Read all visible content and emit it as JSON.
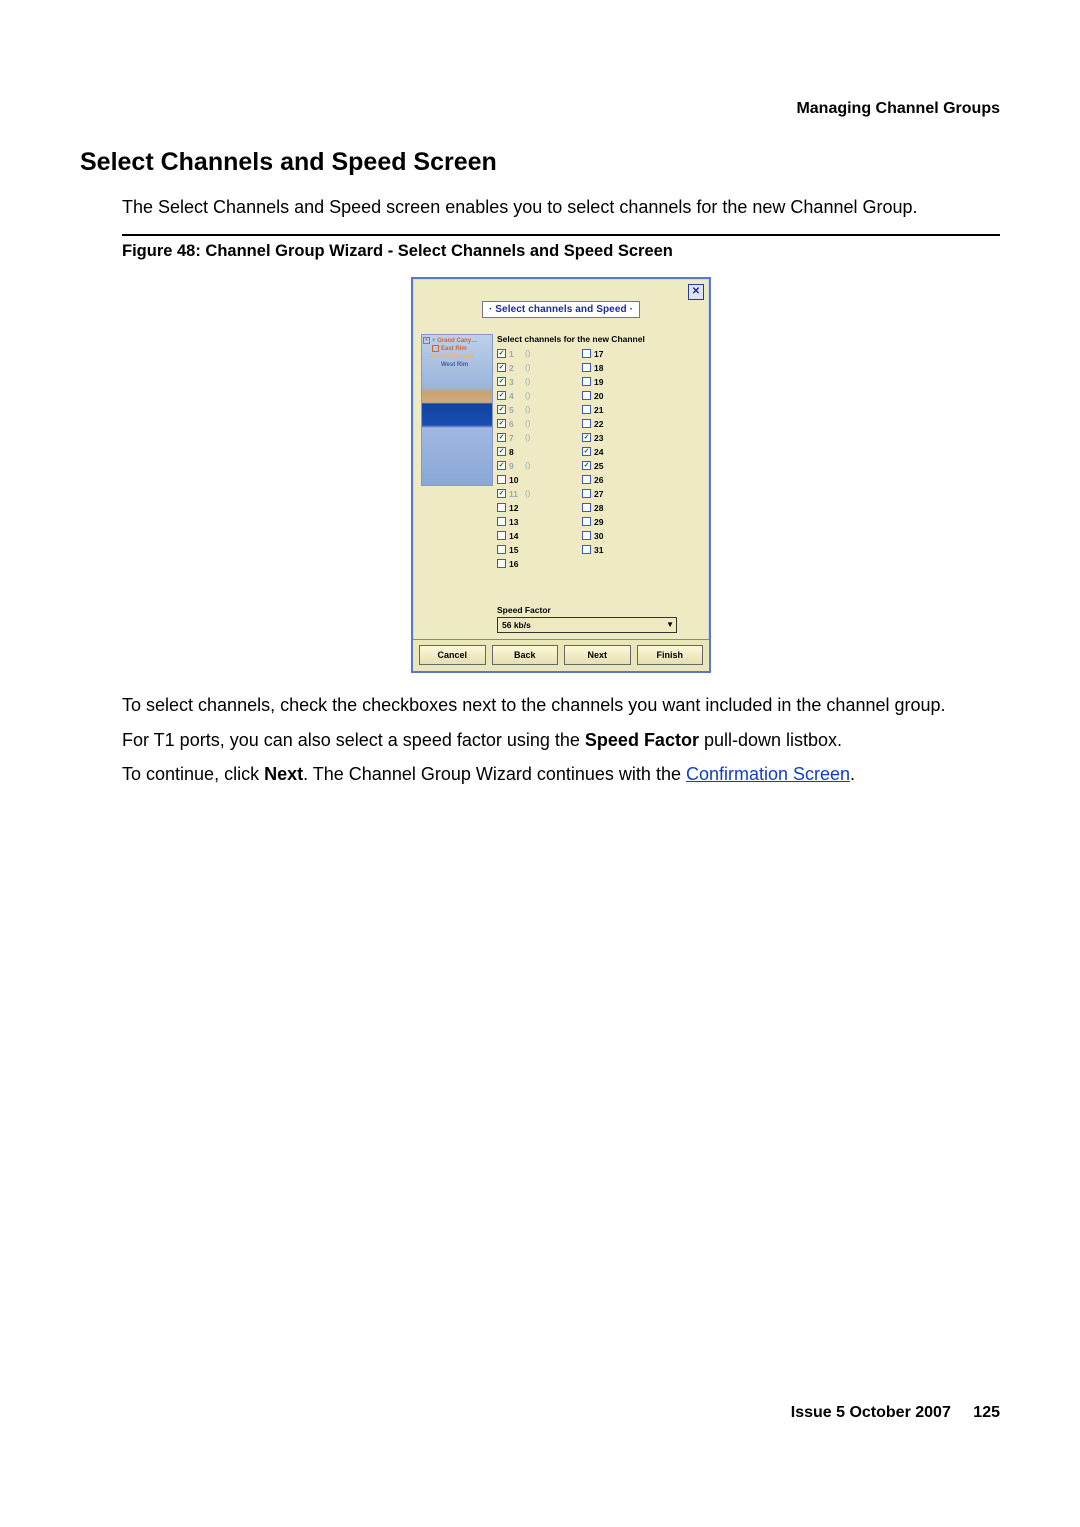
{
  "header": {
    "right": "Managing Channel Groups"
  },
  "h1": "Select Channels and Speed Screen",
  "intro": "The Select Channels and Speed screen enables you to select channels for the new Channel Group.",
  "figure": {
    "caption": "Figure 48: Channel Group Wizard - Select Channels and Speed Screen",
    "title": "· Select channels and Speed ·",
    "close": "✕",
    "heading": "Select channels for the new Channel",
    "tree": [
      "+ Grand Cany…",
      "East Rim",
      "Grand Canyon",
      "West Rim"
    ],
    "channels_col1": [
      {
        "n": "1",
        "checked": true,
        "grey": true,
        "suffix": "()"
      },
      {
        "n": "2",
        "checked": true,
        "grey": true,
        "suffix": "()"
      },
      {
        "n": "3",
        "checked": true,
        "grey": true,
        "suffix": "()"
      },
      {
        "n": "4",
        "checked": true,
        "grey": true,
        "suffix": "()"
      },
      {
        "n": "5",
        "checked": true,
        "grey": true,
        "suffix": "()"
      },
      {
        "n": "6",
        "checked": true,
        "grey": true,
        "suffix": "()"
      },
      {
        "n": "7",
        "checked": true,
        "grey": true,
        "suffix": "()"
      },
      {
        "n": "8",
        "checked": true,
        "grey": false,
        "suffix": ""
      },
      {
        "n": "9",
        "checked": true,
        "grey": true,
        "suffix": "()"
      },
      {
        "n": "10",
        "checked": false,
        "grey": false,
        "suffix": ""
      },
      {
        "n": "11",
        "checked": true,
        "grey": true,
        "suffix": "()"
      },
      {
        "n": "12",
        "checked": false,
        "grey": false,
        "suffix": ""
      },
      {
        "n": "13",
        "checked": false,
        "grey": false,
        "suffix": ""
      },
      {
        "n": "14",
        "checked": false,
        "grey": false,
        "suffix": ""
      },
      {
        "n": "15",
        "checked": false,
        "grey": false,
        "suffix": ""
      },
      {
        "n": "16",
        "checked": false,
        "grey": false,
        "suffix": ""
      }
    ],
    "channels_col2": [
      {
        "n": "17",
        "checked": false,
        "grey": false,
        "suffix": ""
      },
      {
        "n": "18",
        "checked": false,
        "grey": false,
        "suffix": ""
      },
      {
        "n": "19",
        "checked": false,
        "grey": false,
        "suffix": ""
      },
      {
        "n": "20",
        "checked": false,
        "grey": false,
        "suffix": ""
      },
      {
        "n": "21",
        "checked": false,
        "grey": false,
        "suffix": ""
      },
      {
        "n": "22",
        "checked": false,
        "grey": false,
        "suffix": ""
      },
      {
        "n": "23",
        "checked": true,
        "grey": false,
        "suffix": ""
      },
      {
        "n": "24",
        "checked": true,
        "grey": false,
        "suffix": ""
      },
      {
        "n": "25",
        "checked": true,
        "grey": false,
        "suffix": ""
      },
      {
        "n": "26",
        "checked": false,
        "grey": false,
        "suffix": ""
      },
      {
        "n": "27",
        "checked": false,
        "grey": false,
        "suffix": ""
      },
      {
        "n": "28",
        "checked": false,
        "grey": false,
        "suffix": ""
      },
      {
        "n": "29",
        "checked": false,
        "grey": false,
        "suffix": ""
      },
      {
        "n": "30",
        "checked": false,
        "grey": false,
        "suffix": ""
      },
      {
        "n": "31",
        "checked": false,
        "grey": false,
        "suffix": ""
      }
    ],
    "speed_label": "Speed Factor",
    "speed_value": "56 kb/s",
    "buttons": {
      "cancel": "Cancel",
      "back": "Back",
      "next": "Next",
      "finish": "Finish"
    }
  },
  "after": {
    "p1": "To select channels, check the checkboxes next to the channels you want included in the channel group.",
    "p2a": "For T1 ports, you can also select a speed factor using the ",
    "p2b": "Speed Factor",
    "p2c": " pull-down listbox.",
    "p3a": "To continue, click ",
    "p3b": "Next",
    "p3c": ". The Channel Group Wizard continues with the ",
    "p3_link": "Confirmation Screen",
    "p3d": "."
  },
  "footer": {
    "issue": "Issue 5   October 2007",
    "page": "125"
  }
}
